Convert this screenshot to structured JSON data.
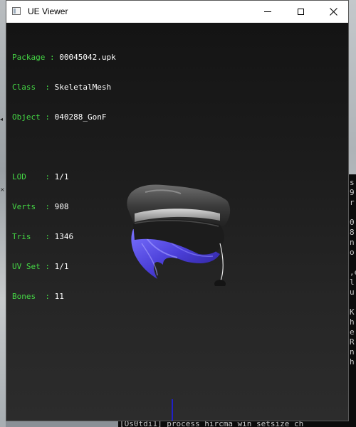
{
  "window": {
    "title": "UE Viewer",
    "controls": {
      "minimize": "minimize",
      "maximize": "maximize",
      "close": "close"
    }
  },
  "info": {
    "lines": [
      {
        "label": "Package",
        "value": "00045042.upk"
      },
      {
        "label": "Class  ",
        "value": "SkeletalMesh"
      },
      {
        "label": "Object ",
        "value": "040288_GonF"
      }
    ],
    "stats": [
      {
        "label": "LOD    ",
        "value": "1/1"
      },
      {
        "label": "Verts  ",
        "value": "908"
      },
      {
        "label": "Tris   ",
        "value": "1346"
      },
      {
        "label": "UV Set ",
        "value": "1/1"
      },
      {
        "label": "Bones  ",
        "value": "11"
      }
    ]
  },
  "background": {
    "console_bottom_text": "[Os0tdi1] process  hircma win setsize  ch",
    "console_fragments": [
      "s",
      "9",
      "r",
      "",
      "0",
      "8",
      "n",
      "o",
      "",
      ",e",
      "l",
      "u",
      "",
      "K",
      "h",
      "e",
      "R",
      "n",
      "h",
      "",
      ""
    ]
  },
  "colors": {
    "label": "#45d845",
    "value": "#ffffff",
    "viewport_bg": "#1c1c1c",
    "hair": "#5b4fe0",
    "cap": "#3a3a3a"
  },
  "icons": {
    "app": "window-icon",
    "close": "close-icon"
  }
}
